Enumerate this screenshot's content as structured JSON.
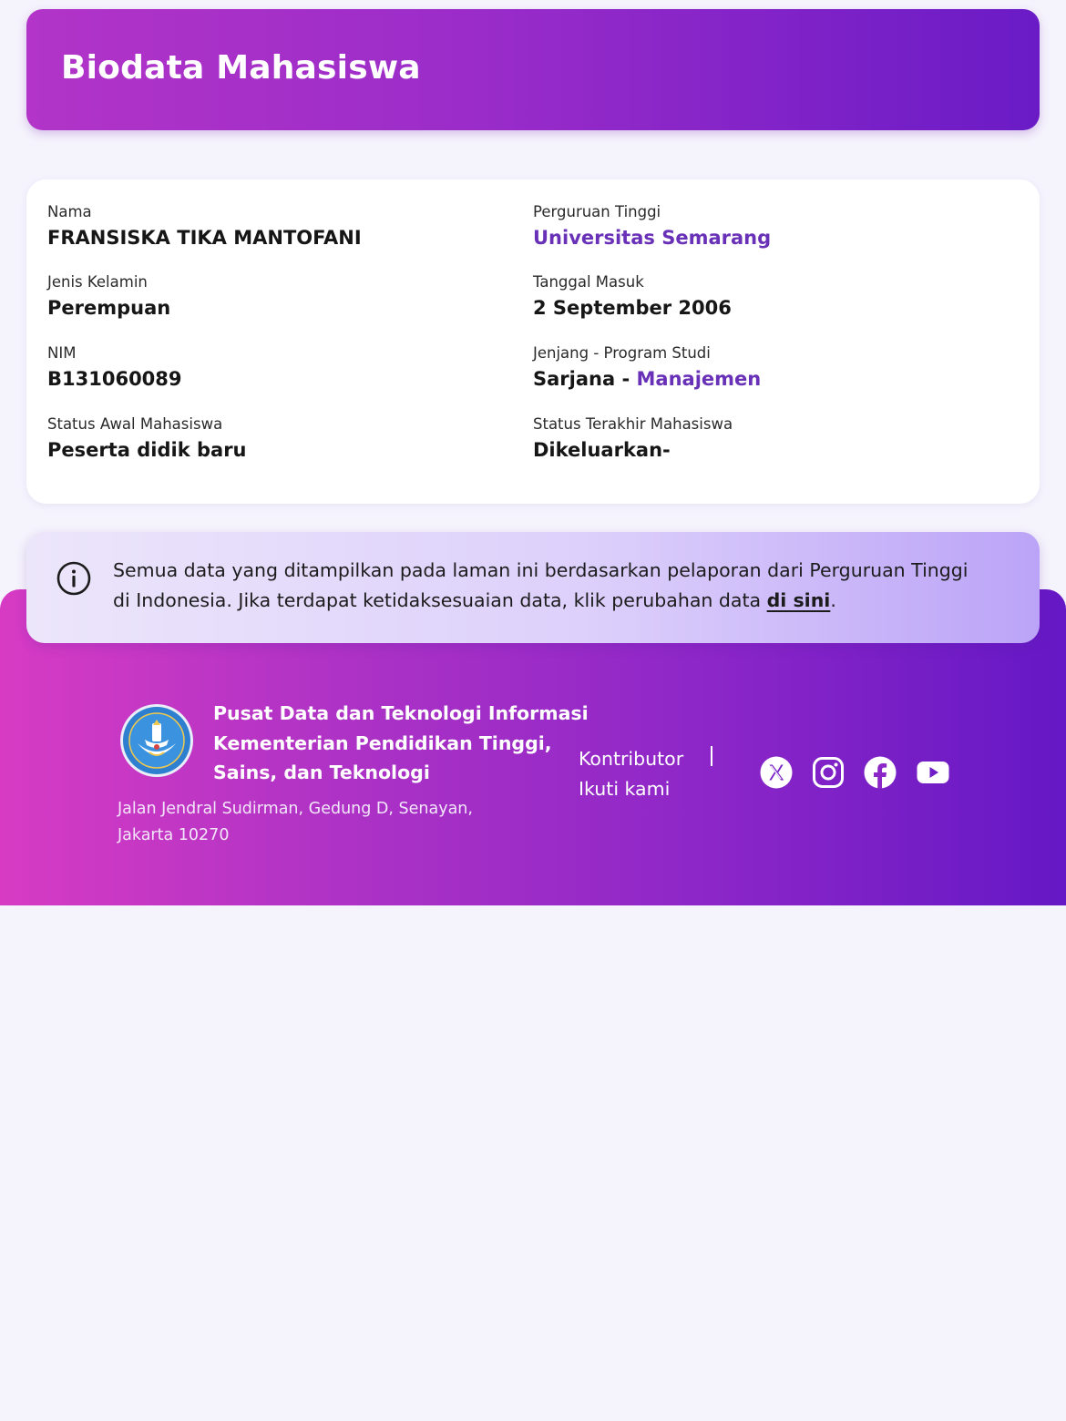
{
  "header": {
    "title": "Biodata Mahasiswa"
  },
  "biodata": {
    "nama": {
      "label": "Nama",
      "value": "FRANSISKA TIKA MANTOFANI"
    },
    "perguruan_tinggi": {
      "label": "Perguruan Tinggi",
      "value": "Universitas Semarang"
    },
    "jenis_kelamin": {
      "label": "Jenis Kelamin",
      "value": "Perempuan"
    },
    "tanggal_masuk": {
      "label": "Tanggal Masuk",
      "value": "2 September 2006"
    },
    "nim": {
      "label": "NIM",
      "value": "B131060089"
    },
    "jenjang_prodi": {
      "label": "Jenjang - Program Studi",
      "jenjang": "Sarjana",
      "separator": " - ",
      "prodi": "Manajemen"
    },
    "status_awal": {
      "label": "Status Awal Mahasiswa",
      "value": "Peserta didik baru"
    },
    "status_terakhir": {
      "label": "Status Terakhir Mahasiswa",
      "value": "Dikeluarkan-"
    }
  },
  "notice": {
    "text": "Semua data yang ditampilkan pada laman ini berdasarkan pelaporan dari Perguruan Tinggi di Indonesia. Jika terdapat ketidaksesuaian data, klik perubahan data ",
    "link_label": "di sini",
    "suffix": "."
  },
  "footer": {
    "org_lines": [
      "Pusat Data dan Teknologi Informasi",
      "Kementerian Pendidikan Tinggi,",
      "Sains, dan Teknologi"
    ],
    "address_lines": [
      "Jalan Jendral Sudirman, Gedung D, Senayan,",
      "Jakarta 10270"
    ],
    "kontributor_label": "Kontributor",
    "ikuti_label": "Ikuti kami",
    "social_icons": [
      "x-icon",
      "instagram-icon",
      "facebook-icon",
      "youtube-icon"
    ]
  },
  "colors": {
    "accent_purple": "#6930b8",
    "header_gradient_start": "#b234c8",
    "header_gradient_end": "#6a1bc6",
    "background": "#f5f3fc"
  }
}
